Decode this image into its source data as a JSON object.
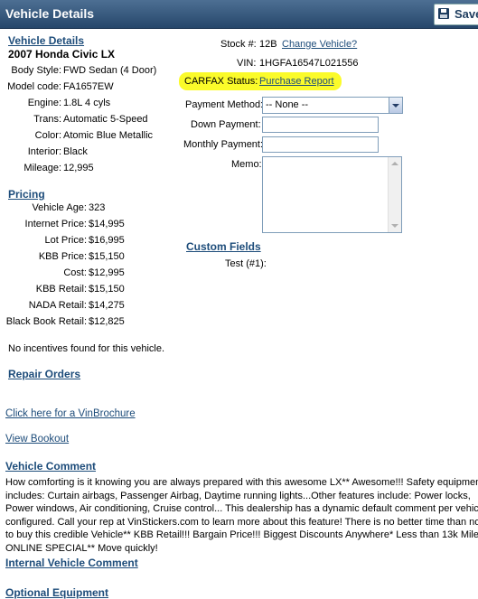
{
  "window": {
    "title": "Vehicle Details",
    "save_label": "Save"
  },
  "vehicle": {
    "section_title": "Vehicle Details",
    "name": "2007 Honda Civic LX",
    "fields": [
      {
        "label": "Body Style:",
        "value": "FWD Sedan (4 Door)"
      },
      {
        "label": "Model code:",
        "value": "FA1657EW"
      },
      {
        "label": "Engine:",
        "value": "1.8L 4 cyls"
      },
      {
        "label": "Trans:",
        "value": "Automatic 5-Speed"
      },
      {
        "label": "Color:",
        "value": "Atomic Blue Metallic"
      },
      {
        "label": "Interior:",
        "value": "Black"
      },
      {
        "label": "Mileage:",
        "value": "12,995"
      }
    ]
  },
  "stock": {
    "label": "Stock #:",
    "value": "12B",
    "change_link": "Change Vehicle?"
  },
  "vin": {
    "label": "VIN:",
    "value": "1HGFA16547L021556"
  },
  "carfax": {
    "label": "CARFAX Status:",
    "link": "Purchase Report"
  },
  "payment": {
    "method_label": "Payment Method:",
    "method_value": "-- None --",
    "down_label": "Down Payment:",
    "down_value": "",
    "monthly_label": "Monthly Payment:",
    "monthly_value": "",
    "memo_label": "Memo:"
  },
  "pricing": {
    "section_title": "Pricing",
    "rows": [
      {
        "label": "Vehicle Age:",
        "value": "323"
      },
      {
        "label": "Internet Price:",
        "value": "$14,995"
      },
      {
        "label": "Lot Price:",
        "value": "$16,995"
      },
      {
        "label": "KBB Price:",
        "value": "$15,150"
      },
      {
        "label": "Cost:",
        "value": "$12,995"
      },
      {
        "label": "KBB Retail:",
        "value": "$15,150"
      },
      {
        "label": "NADA Retail:",
        "value": "$14,275"
      },
      {
        "label": "Black Book Retail:",
        "value": "$12,825"
      }
    ],
    "incentives_note": "No incentives found for this vehicle."
  },
  "custom_fields": {
    "section_title": "Custom Fields",
    "test_label": "Test (#1):"
  },
  "repair_orders": {
    "label": "Repair Orders"
  },
  "vinbrochure_link": "Click here for a VinBrochure",
  "bookout_link": "View Bookout",
  "vehicle_comment": {
    "section_title": "Vehicle Comment",
    "text": "How comforting is it knowing you are always prepared with this awesome LX** Awesome!!! Safety equipment includes: Curtain airbags, Passenger Airbag, Daytime running lights...Other features include: Power locks, Power windows, Air conditioning, Cruise control... This dealership has a dynamic default comment per vehicle configured. Call your rep at VinStickers.com to learn more about this feature! There is no better time than now to buy this credible Vehicle** KBB Retail!!! Bargain Price!!! Biggest Discounts Anywhere* Less than 13k Miles... ONLINE SPECIAL** Move quickly!"
  },
  "internal_comment": {
    "section_title": "Internal Vehicle Comment"
  },
  "optional_equipment": {
    "section_title": "Optional Equipment"
  },
  "colors": {
    "title_bar": "#2f5076",
    "link": "#1d4c7a",
    "highlight": "#fbfb2a"
  }
}
